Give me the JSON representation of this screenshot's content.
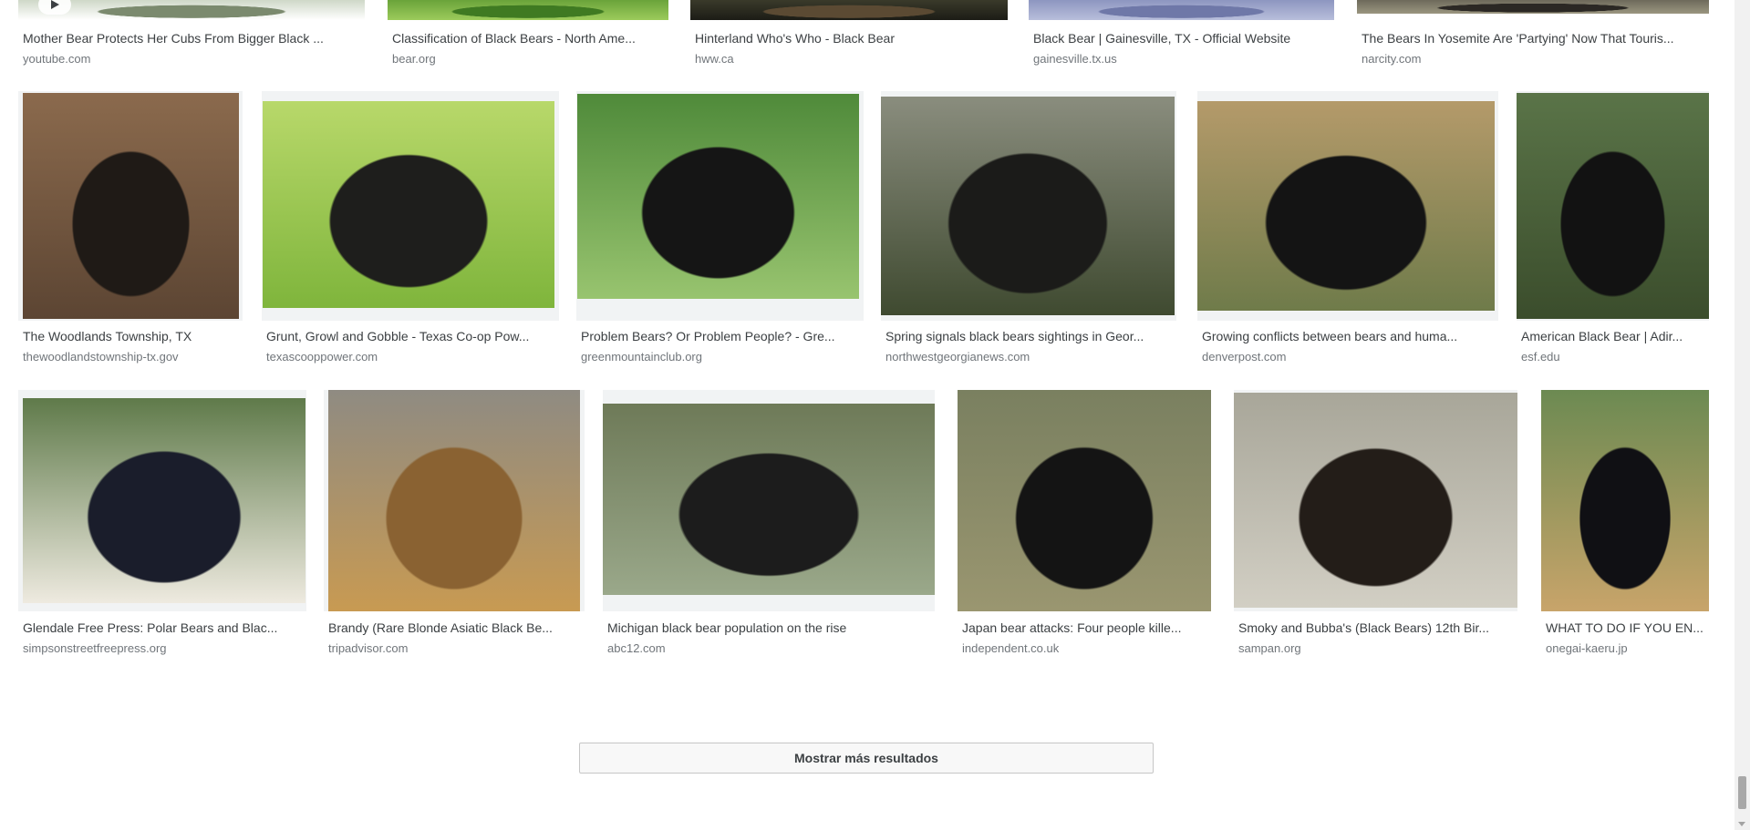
{
  "rows": [
    {
      "items": [
        {
          "caption": "Mother Bear Protects Her Cubs From Bigger Black ...",
          "source": "youtube.com",
          "colors": [
            "#cfd8c8",
            "#7b8a6e",
            "#ffffff"
          ],
          "video": true
        },
        {
          "caption": "Classification of Black Bears - North Ame...",
          "source": "bear.org",
          "colors": [
            "#6aa33a",
            "#3f7a22",
            "#9ccb5b"
          ]
        },
        {
          "caption": "Hinterland Who's Who - Black Bear",
          "source": "hww.ca",
          "colors": [
            "#3a3a2a",
            "#5b4a33",
            "#1c1c16"
          ]
        },
        {
          "caption": "Black Bear | Gainesville, TX - Official Website",
          "source": "gainesville.tx.us",
          "colors": [
            "#8d96c0",
            "#6f78a8",
            "#b8bedb"
          ]
        },
        {
          "caption": "The Bears In Yosemite Are 'Partying' Now That Touris...",
          "source": "narcity.com",
          "colors": [
            "#6e6a5b",
            "#2b2824",
            "#9b9680"
          ]
        }
      ]
    },
    {
      "items": [
        {
          "caption": "The Woodlands Township, TX",
          "source": "thewoodlandstownship-tx.gov",
          "colors": [
            "#8b6a4d",
            "#1f1a16",
            "#5c4533"
          ]
        },
        {
          "caption": "Grunt, Growl and Gobble - Texas Co-op Pow...",
          "source": "texascooppower.com",
          "colors": [
            "#b8d86a",
            "#1e1e1c",
            "#7fb53c"
          ]
        },
        {
          "caption": "Problem Bears? Or Problem People? - Gre...",
          "source": "greenmountainclub.org",
          "colors": [
            "#4f8a3a",
            "#151515",
            "#98c46f"
          ]
        },
        {
          "caption": "Spring signals black bears sightings in Geor...",
          "source": "northwestgeorgianews.com",
          "colors": [
            "#8a8d7e",
            "#1b1b19",
            "#3f4a30"
          ]
        },
        {
          "caption": "Growing conflicts between bears and huma...",
          "source": "denverpost.com",
          "colors": [
            "#b49a6a",
            "#141414",
            "#6f7b4a"
          ]
        },
        {
          "caption": "American Black Bear | Adir...",
          "source": "esf.edu",
          "colors": [
            "#5a7448",
            "#121212",
            "#3b4d2c"
          ]
        }
      ]
    },
    {
      "items": [
        {
          "caption": "Glendale Free Press: Polar Bears and Blac...",
          "source": "simpsonstreetfreepress.org",
          "colors": [
            "#5f7a4a",
            "#1a1d2b",
            "#eeeae0"
          ]
        },
        {
          "caption": "Brandy (Rare Blonde Asiatic Black Be...",
          "source": "tripadvisor.com",
          "colors": [
            "#8f8b82",
            "#8a6232",
            "#c89a52"
          ]
        },
        {
          "caption": "Michigan black bear population on the rise",
          "source": "abc12.com",
          "colors": [
            "#6e7a58",
            "#1c1c1c",
            "#9aa88a"
          ]
        },
        {
          "caption": "Japan bear attacks: Four people kille...",
          "source": "independent.co.uk",
          "colors": [
            "#7a8060",
            "#141414",
            "#9a9670"
          ]
        },
        {
          "caption": "Smoky and Bubba's (Black Bears) 12th Bir...",
          "source": "sampan.org",
          "colors": [
            "#a8a699",
            "#231d18",
            "#d2cfc4"
          ]
        },
        {
          "caption": "WHAT TO DO IF YOU EN...",
          "source": "onegai-kaeru.jp",
          "colors": [
            "#6c8a52",
            "#101014",
            "#c8a46a"
          ]
        }
      ]
    }
  ],
  "more_button": {
    "label": "Mostrar más resultados"
  }
}
